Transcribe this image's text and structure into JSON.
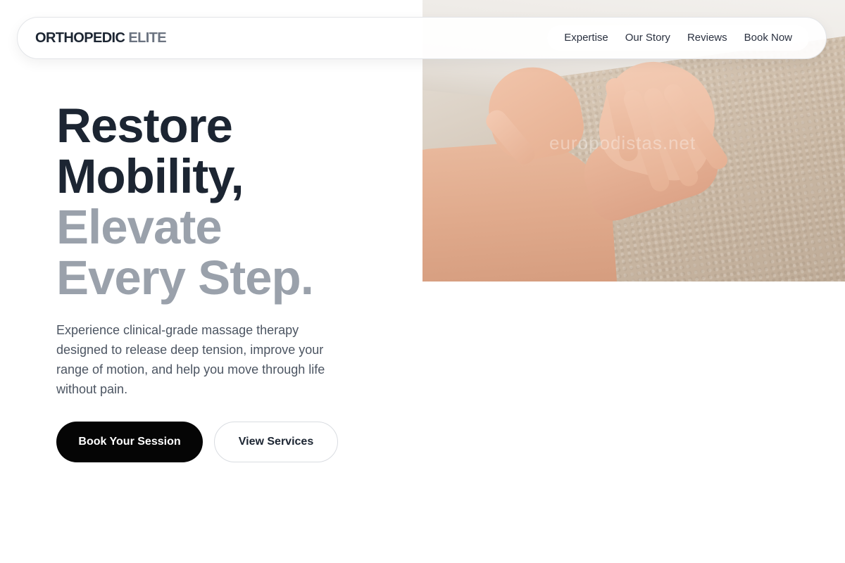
{
  "brand": {
    "primary": "ORTHOPEDIC",
    "accent": "ELITE"
  },
  "nav": {
    "links": [
      {
        "label": "Expertise"
      },
      {
        "label": "Our Story"
      },
      {
        "label": "Reviews"
      },
      {
        "label": "Book Now"
      }
    ]
  },
  "hero": {
    "headline_dark": [
      "Restore",
      "Mobility,"
    ],
    "headline_muted": [
      "Elevate",
      "Every Step."
    ],
    "description": "Experience clinical-grade massage therapy designed to release deep tension, improve your range of motion, and help you move through life without pain.",
    "primary_cta": "Book Your Session",
    "secondary_cta": "View Services",
    "image": {
      "subject": "hands massaging a forearm on a beige towel",
      "watermark": "europodistas.net"
    }
  },
  "colors": {
    "text_dark": "#1c2532",
    "text_muted": "#9aa1ab",
    "body_text": "#4c5562",
    "primary_button": "#050505",
    "page_background": "#ffffff"
  }
}
